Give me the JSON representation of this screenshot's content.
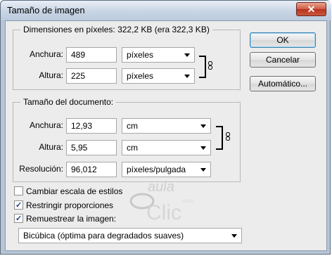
{
  "window": {
    "title": "Tamaño de imagen",
    "close_label": "✕"
  },
  "pixel_dimensions": {
    "title": "Dimensiones en píxeles: 322,2 KB (era 322,3 KB)",
    "width_label": "Anchura:",
    "width_value": "489",
    "width_unit": "píxeles",
    "height_label": "Altura:",
    "height_value": "225",
    "height_unit": "píxeles"
  },
  "document_size": {
    "title": "Tamaño del documento:",
    "width_label": "Anchura:",
    "width_value": "12,93",
    "width_unit": "cm",
    "height_label": "Altura:",
    "height_value": "5,95",
    "height_unit": "cm",
    "resolution_label": "Resolución:",
    "resolution_value": "96,012",
    "resolution_unit": "píxeles/pulgada"
  },
  "buttons": {
    "ok": "OK",
    "cancel": "Cancelar",
    "auto": "Automático..."
  },
  "options": {
    "scale_styles": {
      "label": "Cambiar escala de estilos",
      "checked": false
    },
    "constrain": {
      "label": "Restringir proporciones",
      "checked": true
    },
    "resample": {
      "label": "Remuestrear la imagen:",
      "checked": true
    },
    "resample_method": "Bicúbica (óptima para degradados suaves)"
  },
  "watermark": {
    "top": "aula",
    "bottom": "Clic",
    "small": "com"
  },
  "colors": {
    "title_gradient_top": "#e9eff6",
    "close_red": "#c9573c",
    "dialog_bg": "#ececec",
    "watermark": "#c8c8c8"
  },
  "icons": [
    "close-icon",
    "chain-link-icon",
    "checkmark-icon",
    "dropdown-arrow-icon"
  ]
}
